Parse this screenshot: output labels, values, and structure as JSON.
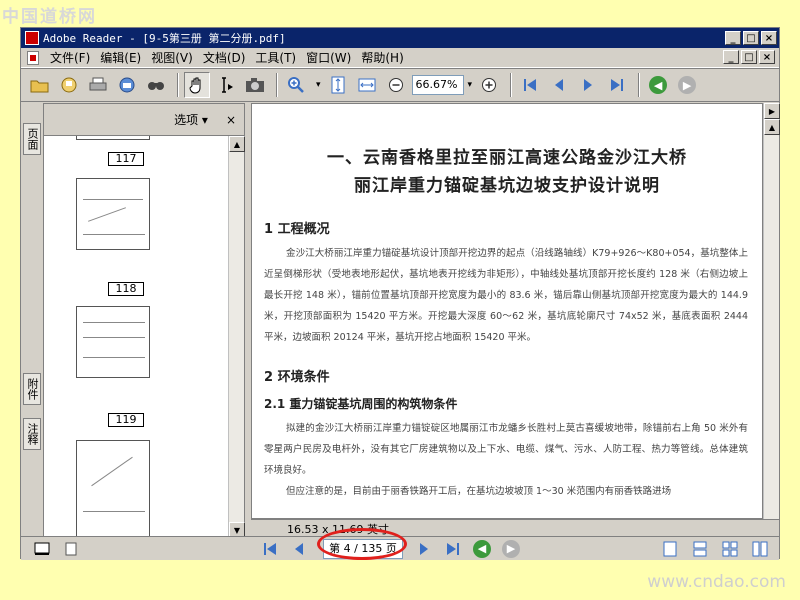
{
  "watermark_top": "中国道桥网",
  "watermark_bottom": "www.cndao.com",
  "window": {
    "title": "Adobe Reader - [9-5第三册  第二分册.pdf]",
    "controls": {
      "minimize": "_",
      "maximize": "□",
      "close": "×"
    }
  },
  "menu": {
    "items": [
      "文件(F)",
      "编辑(E)",
      "视图(V)",
      "文档(D)",
      "工具(T)",
      "窗口(W)",
      "帮助(H)"
    ]
  },
  "toolbar": {
    "zoom_value": "66.67%",
    "icons": [
      "open-icon",
      "save-icon",
      "print-icon",
      "email-icon",
      "search-icon",
      "hand-tool-icon",
      "select-text-icon",
      "snapshot-icon",
      "zoom-in-icon",
      "fit-page-icon",
      "fit-width-icon",
      "zoom-out-icon",
      "zoom-plus-icon",
      "first-page-icon",
      "prev-page-icon",
      "next-page-icon",
      "last-page-icon",
      "go-back-icon",
      "go-forward-icon"
    ]
  },
  "nav_tabs": [
    "页面",
    "附件",
    "注释"
  ],
  "sidebar": {
    "options_label": "选项",
    "close_label": "×",
    "thumbnails": [
      "117",
      "118",
      "119"
    ]
  },
  "document": {
    "title_line1": "一、云南香格里拉至丽江高速公路金沙江大桥",
    "title_line2": "丽江岸重力锚碇基坑边坡支护设计说明",
    "section1_heading": "1 工程概况",
    "section1_para": "金沙江大桥丽江岸重力锚碇基坑设计顶部开挖边界的起点（沿线路轴线）K79+926～K80+054，基坑整体上近呈倒梯形状（受地表地形起伏，基坑地表开挖线为非矩形），中轴线处基坑顶部开挖长度约 128 米（右侧边坡上最长开挖 148 米），锚前位置基坑顶部开挖宽度为最小的 83.6 米，锚后靠山侧基坑顶部开挖宽度为最大的 144.9 米，开挖顶部面积为 15420 平方米。开挖最大深度 60～62 米，基坑底轮廓尺寸 74x52 米，基底表面积 2444 平米，边坡面积 20124 平米，基坑开挖占地面积 15420 平米。",
    "section2_heading": "2 环境条件",
    "section21_heading": "2.1 重力锚锭基坑周围的构筑物条件",
    "section21_para1": "拟建的金沙江大桥丽江岸重力锚锭碇区地属丽江市龙蟠乡长胜村上莫古喜缓坡地带，除锚前右上角 50 米外有零星两户民房及电杆外，没有其它厂房建筑物以及上下水、电缆、煤气、污水、人防工程、热力等管线。总体建筑环境良好。",
    "section21_para2": "但应注意的是，目前由于丽香铁路开工后，在基坑边坡坡顶 1～30 米范围内有丽香铁路进场"
  },
  "page_size": "16.53 x 11.69 英寸",
  "status": {
    "page_indicator": "第 4 / 135 页"
  },
  "colors": {
    "titlebar": "#0A246A",
    "chrome": "#D4D0C8",
    "highlight": "#E0201C",
    "background": "#FFFFB0"
  }
}
